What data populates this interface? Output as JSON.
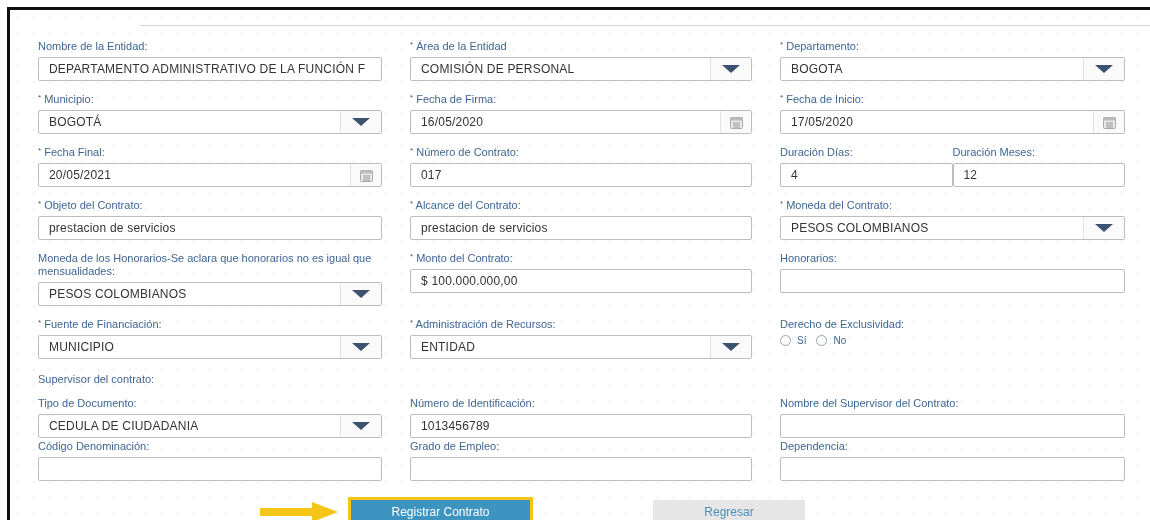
{
  "form": {
    "rows": [
      [
        {
          "kind": "text",
          "label": "Nombre de la Entidad:",
          "value": "DEPARTAMENTO ADMINISTRATIVO DE LA FUNCIÓN F"
        },
        {
          "kind": "select",
          "label": "$^{*}$ Área de la Entidad",
          "value": "COMISIÓN DE PERSONAL"
        },
        {
          "kind": "select",
          "label": "$^{*}$ Departamento:",
          "value": "BOGOTA"
        }
      ],
      [
        {
          "kind": "select",
          "label": "$^{*}$ Municipio:",
          "value": "BOGOTÁ"
        },
        {
          "kind": "date",
          "label": "$^{*}$ Fecha de Firma:",
          "value": "16/05/2020"
        },
        {
          "kind": "date",
          "label": "$^{*}$ Fecha de Inicio:",
          "value": "17/05/2020"
        }
      ],
      [
        {
          "kind": "date",
          "label": "$^{*}$ Fecha Final:",
          "value": "20/05/2021"
        },
        {
          "kind": "text",
          "label": "$^{*}$ Número de Contrato:",
          "value": "017"
        },
        {
          "kind": "pair",
          "parts": [
            {
              "kind": "text",
              "label": "Duración Días:",
              "value": "4"
            },
            {
              "kind": "text",
              "label": "Duración Meses:",
              "value": "12"
            }
          ]
        }
      ],
      [
        {
          "kind": "text",
          "label": "$^{*}$ Objeto del Contrato:",
          "value": "prestacion de servicios"
        },
        {
          "kind": "text",
          "label": "$^{*}$ Alcance del Contrato:",
          "value": "prestacion de servicios"
        },
        {
          "kind": "select",
          "label": "$^{*}$ Moneda del Contrato:",
          "value": "PESOS COLOMBIANOS"
        }
      ],
      [
        {
          "kind": "select",
          "label": "Moneda de los Honorarios-Se aclara que honorarios no es igual que mensualidades:",
          "value": "PESOS COLOMBIANOS"
        },
        {
          "kind": "text",
          "label": "$^{*}$ Monto del Contrato:",
          "value": "$ 100.000.000,00"
        },
        {
          "kind": "text",
          "label": "Honorarios:"
        }
      ],
      [
        {
          "kind": "select",
          "label": "$^{*}$ Fuente de Financiación:",
          "value": "MUNICIPIO"
        },
        {
          "kind": "select",
          "label": "$^{*}$ Administración de Recursos:",
          "value": "ENTIDAD"
        },
        {
          "kind": "radio",
          "label": "Derecho de Exclusividad:",
          "options": [
            {
              "label": "Sí",
              "selected": false
            },
            {
              "label": "No",
              "selected": false
            }
          ]
        }
      ]
    ]
  },
  "supervisor": {
    "title": "Supervisor del contrato:",
    "rows": [
      [
        {
          "kind": "select",
          "label": "Tipo de Documento:",
          "value": "CEDULA DE CIUDADANIA"
        },
        {
          "kind": "text",
          "label": "Número de Identificación:",
          "value": "1013456789"
        },
        {
          "kind": "text",
          "label": "Nombre del Supervisor del Contrato:"
        }
      ],
      [
        {
          "kind": "text",
          "label": "Código Denominación:"
        },
        {
          "kind": "text",
          "label": "Grado de Empleo:"
        },
        {
          "kind": "text",
          "label": "Dependencia:"
        }
      ]
    ]
  },
  "actions": [
    {
      "label": "Registrar Contrato",
      "kind": "primary",
      "highlighted": true
    },
    {
      "label": "Regresar",
      "kind": "secondary",
      "highlighted": false
    }
  ]
}
